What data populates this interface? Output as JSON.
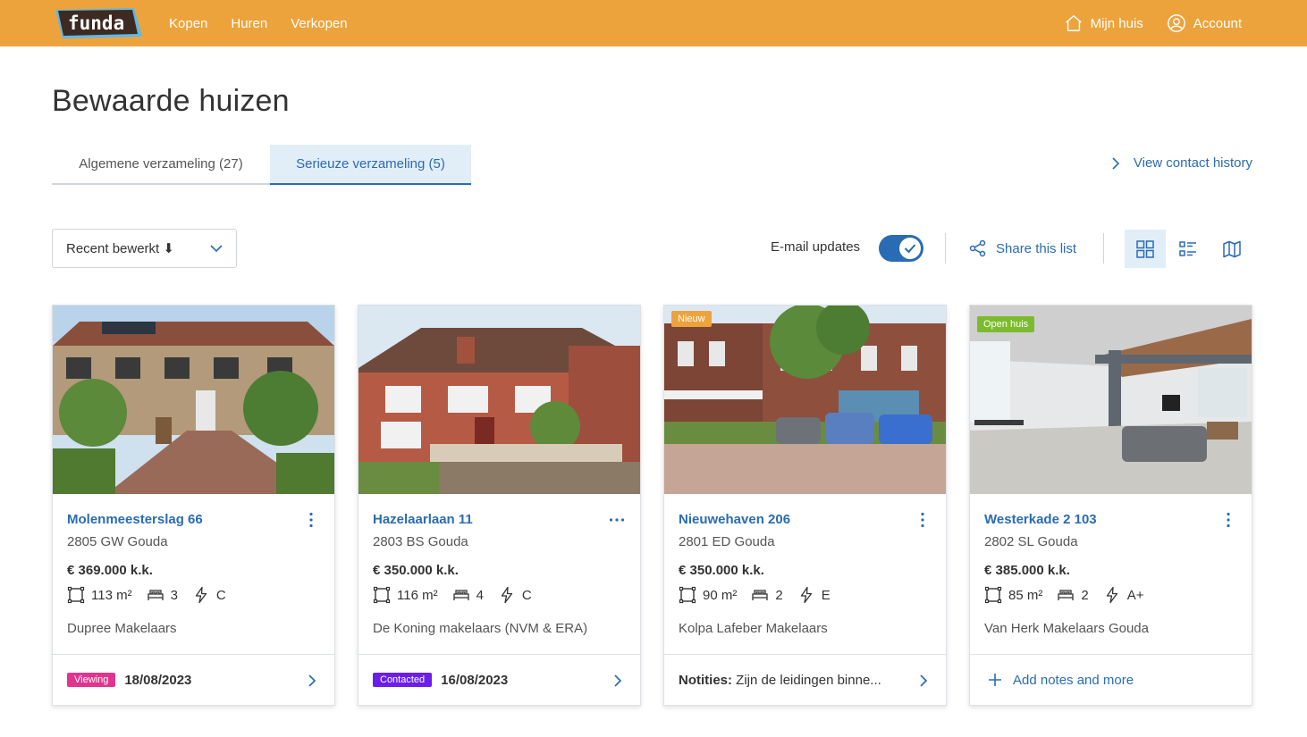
{
  "header": {
    "logo_text": "funda",
    "nav": [
      "Kopen",
      "Huren",
      "Verkopen"
    ],
    "my_home": "Mijn huis",
    "account": "Account",
    "brand_color": "#eda33c"
  },
  "page": {
    "title": "Bewaarde huizen",
    "tabs": [
      {
        "label": "Algemene verzameling (27)",
        "active": false
      },
      {
        "label": "Serieuze verzameling (5)",
        "active": true
      }
    ],
    "contact_history": "View contact history"
  },
  "toolbar": {
    "sort_label": "Recent bewerkt ⬇",
    "email_updates": "E-mail updates",
    "email_updates_on": true,
    "share_label": "Share this list",
    "views": [
      "grid-view-icon",
      "list-view-icon",
      "map-view-icon"
    ],
    "active_view": "grid-view-icon"
  },
  "cards": [
    {
      "badge": "",
      "address": "Molenmeesterslag 66",
      "postal": "2805 GW Gouda",
      "price": "€ 369.000 k.k.",
      "area": "113 m²",
      "rooms": "3",
      "energy": "C",
      "agent": "Dupree Makelaars",
      "footer": {
        "status": "Viewing",
        "status_color": "#e0358f",
        "date": "18/08/2023"
      }
    },
    {
      "badge": "",
      "address": "Hazelaarlaan 11",
      "postal": "2803 BS Gouda",
      "price": "€ 350.000 k.k.",
      "area": "116 m²",
      "rooms": "4",
      "energy": "C",
      "agent": "De Koning makelaars (NVM & ERA)",
      "footer": {
        "status": "Contacted",
        "status_color": "#6c1ee8",
        "date": "16/08/2023"
      }
    },
    {
      "badge": "Nieuw",
      "badge_color": "#eda33c",
      "address": "Nieuwehaven 206",
      "postal": "2801 ED Gouda",
      "price": "€ 350.000 k.k.",
      "area": "90 m²",
      "rooms": "2",
      "energy": "E",
      "agent": "Kolpa Lafeber Makelaars",
      "footer": {
        "note_label": "Notities:",
        "note_text": "Zijn de leidingen binne..."
      }
    },
    {
      "badge": "Open huis",
      "badge_color": "#7dbb2e",
      "address": "Westerkade 2 103",
      "postal": "2802 SL Gouda",
      "price": "€ 385.000 k.k.",
      "area": "85 m²",
      "rooms": "2",
      "energy": "A+",
      "agent": "Van Herk Makelaars Gouda",
      "footer": {
        "add_label": "Add notes and more"
      }
    }
  ]
}
